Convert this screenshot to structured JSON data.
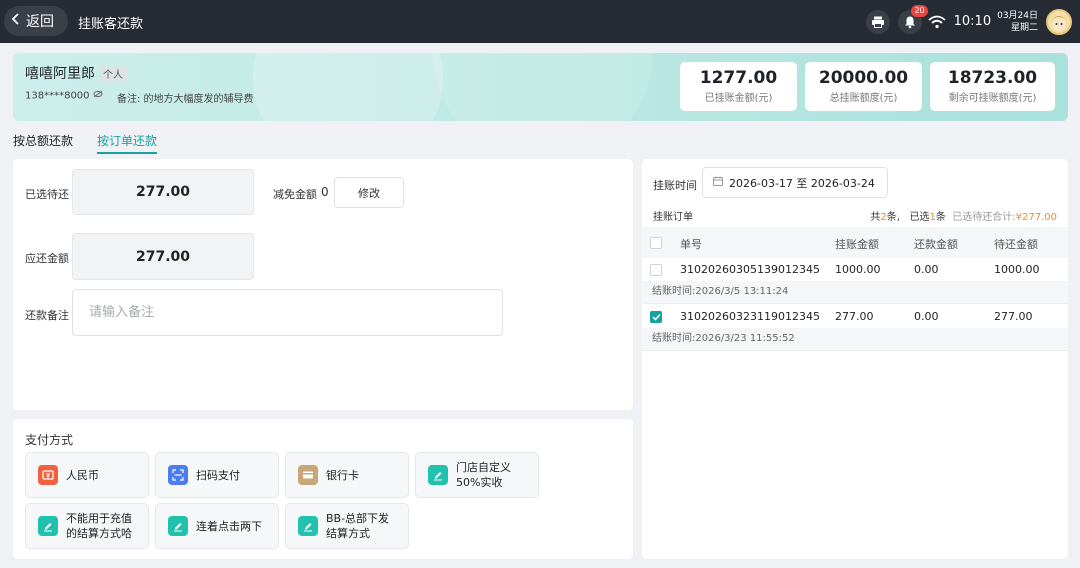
{
  "header": {
    "back_label": "返回",
    "title": "挂账客还款",
    "notification_count": "20",
    "time": "10:10",
    "date": "03月24日",
    "weekday": "星期二"
  },
  "customer": {
    "name": "嘻嘻阿里郎",
    "tag": "个人",
    "phone": "138****8000",
    "remark": "备注: 的地方大幅度发的辅导费",
    "stats": [
      {
        "value": "1277.00",
        "label": "已挂账金额(元)"
      },
      {
        "value": "20000.00",
        "label": "总挂账额度(元)"
      },
      {
        "value": "18723.00",
        "label": "剩余可挂账额度(元)"
      }
    ]
  },
  "tabs": [
    {
      "label": "按总额还款",
      "active": false
    },
    {
      "label": "按订单还款",
      "active": true
    }
  ],
  "form": {
    "selected_label": "已选待还",
    "selected_value": "277.00",
    "discount_label": "减免金额",
    "discount_value": "0",
    "edit_label": "修改",
    "due_label": "应还金额",
    "due_value": "277.00",
    "note_label": "还款备注",
    "note_placeholder": "请输入备注"
  },
  "payment": {
    "title": "支付方式",
    "methods": [
      {
        "label": "人民币",
        "icon": "cash-icon",
        "color": "#f0623f"
      },
      {
        "label": "扫码支付",
        "icon": "scan-icon",
        "color": "#4c7df0"
      },
      {
        "label": "银行卡",
        "icon": "bank-card-icon",
        "color": "#c9a678"
      },
      {
        "label": "门店自定义 50%实收",
        "line1": "门店自定义",
        "line2": "50%实收",
        "icon": "edit-icon",
        "color": "#20c1ad"
      },
      {
        "label": "不能用于充值 的结算方式哈",
        "line1": "不能用于充值",
        "line2": "的结算方式哈",
        "icon": "edit-icon",
        "color": "#20c1ad"
      },
      {
        "label": "连着点击两下",
        "icon": "edit-icon",
        "color": "#20c1ad"
      },
      {
        "label": "BB-总部下发 结算方式",
        "line1": "BB-总部下发",
        "line2": "结算方式",
        "icon": "edit-icon",
        "color": "#20c1ad"
      }
    ]
  },
  "orders": {
    "date_label": "挂账时间",
    "date_range": "2026-03-17 至 2026-03-24",
    "list_title": "挂账订单",
    "summary_total_pre": "共",
    "summary_total": "2",
    "summary_total_post": "条,",
    "summary_sel_pre": "已选",
    "summary_sel": "1",
    "summary_sel_post": "条",
    "summary_amount_label": "已选待还合计:",
    "summary_amount": "¥277.00",
    "columns": [
      "单号",
      "挂账金额",
      "还款金额",
      "待还金额"
    ],
    "rows": [
      {
        "id": "3102026030513901234​5",
        "order_no": "31020260305139012345",
        "amount": "1000.00",
        "paid": "0.00",
        "due": "1000.00",
        "time": "结账时间:2026/3/5 13:11:24",
        "checked": false
      },
      {
        "order_no": "31020260323119012345",
        "amount": "277.00",
        "paid": "0.00",
        "due": "277.00",
        "time": "结账时间:2026/3/23 11:55:52",
        "checked": true
      }
    ]
  },
  "colors": {
    "accent": "#17a2a0",
    "topbar": "#262b34",
    "orange": "#f28a2e"
  }
}
